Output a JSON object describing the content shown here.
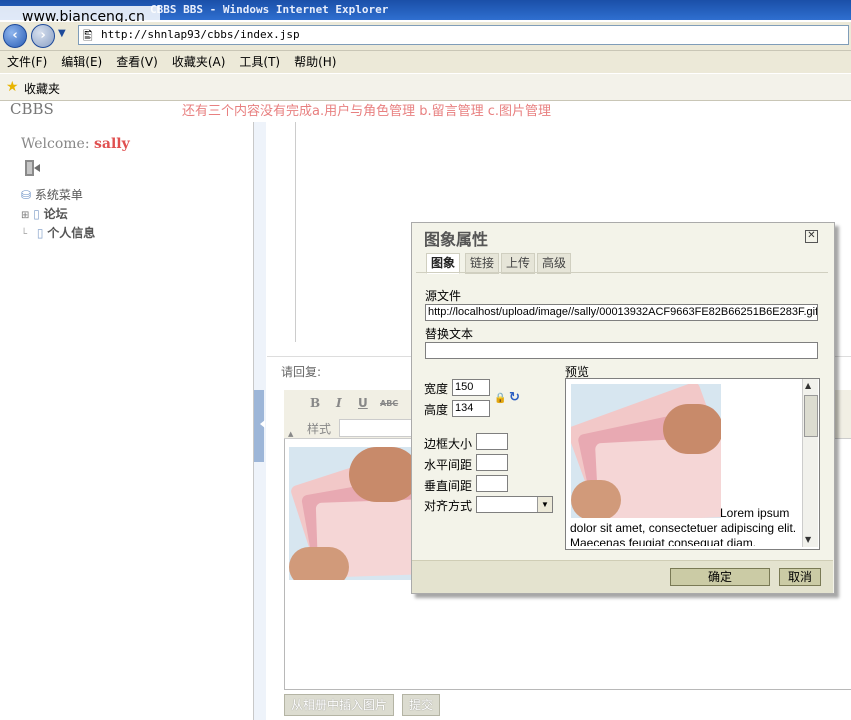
{
  "browser": {
    "title": "CBBS BBS - Windows Internet Explorer",
    "watermark": "www.bianceng.cn",
    "url": "http://shnlap93/cbbs/index.jsp",
    "menu": [
      "文件(F)",
      "编辑(E)",
      "查看(V)",
      "收藏夹(A)",
      "工具(T)",
      "帮助(H)"
    ],
    "favorites": "收藏夹"
  },
  "page": {
    "logo": "CBBS",
    "notice": "还有三个内容没有完成a.用户与角色管理 b.留言管理 c.图片管理",
    "welcome_prefix": "Welcome: ",
    "username": "sally",
    "tree": {
      "root": "系统菜单",
      "items": [
        "论坛",
        "个人信息"
      ]
    },
    "reply_label": "请回复:",
    "toolbar": {
      "bold": "B",
      "italic": "I",
      "underline": "U",
      "strike": "ABC",
      "style_label": "样式"
    },
    "insert_button": "从相册中插入图片",
    "submit_button": "提交"
  },
  "dialog": {
    "title": "图象属性",
    "tabs": [
      "图象",
      "链接",
      "上传",
      "高级"
    ],
    "active_tab": "图象",
    "source_label": "源文件",
    "source_value": "http://localhost/upload/image//sally/00013932ACF9663FE82B66251B6E283F.gif",
    "alt_label": "替换文本",
    "alt_value": "",
    "width_label": "宽度",
    "width_value": "150",
    "height_label": "高度",
    "height_value": "134",
    "border_label": "边框大小",
    "hspace_label": "水平间距",
    "vspace_label": "垂直间距",
    "align_label": "对齐方式",
    "preview_label": "预览",
    "preview_text": "Lorem ipsum dolor sit amet, consectetuer adipiscing elit. Maecenas feugiat consequat diam.",
    "ok": "确定",
    "cancel": "取消"
  }
}
